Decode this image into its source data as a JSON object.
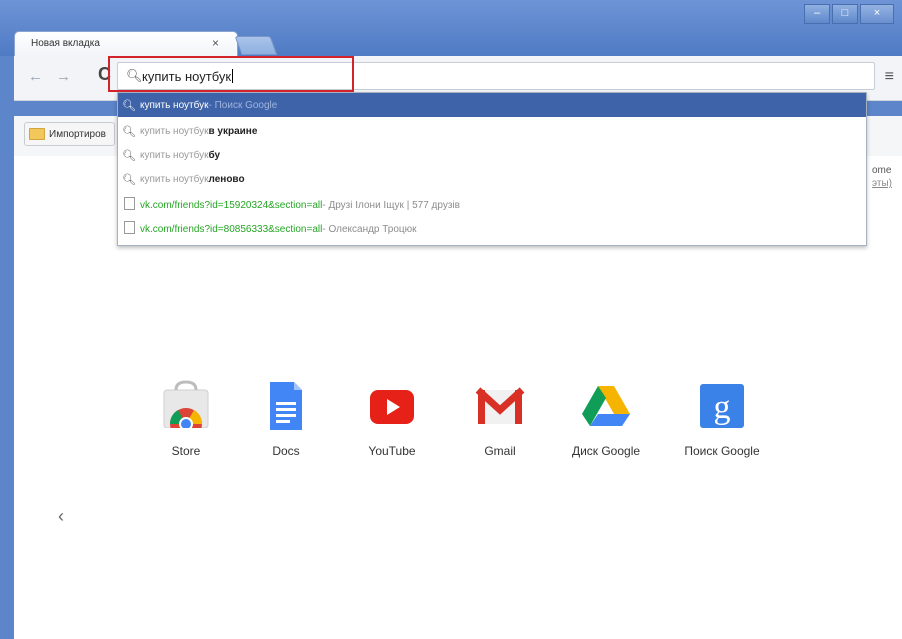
{
  "window": {
    "tab_title": "Новая вкладка",
    "tab_close": "×",
    "buttons": {
      "minimize": "–",
      "maximize": "□",
      "close": "×"
    }
  },
  "toolbar": {
    "back": "←",
    "forward": "→",
    "reload": "C",
    "omnibox_value": "купить ноутбук",
    "menu": "≡"
  },
  "bookmarks": {
    "item_label": "Импортиров"
  },
  "suggestions": [
    {
      "icon": "search-icon",
      "query": "купить ноутбук",
      "bold": "",
      "desc": " - Поиск Google",
      "selected": true
    },
    {
      "icon": "search-icon",
      "query": "купить ноутбук ",
      "bold": "в украине",
      "desc": "",
      "selected": false
    },
    {
      "icon": "search-icon",
      "query": "купить ноутбук ",
      "bold": "бу",
      "desc": "",
      "selected": false
    },
    {
      "icon": "search-icon",
      "query": "купить ноутбук ",
      "bold": "леново",
      "desc": "",
      "selected": false
    },
    {
      "icon": "page-icon",
      "url": "vk.com/friends?id=15920324&section=all",
      "desc": " - Друзі Ілони Іщук | 577 друзів",
      "selected": false
    },
    {
      "icon": "page-icon",
      "url": "vk.com/friends?id=80856333&section=all",
      "desc": " - Олександр Троцюк",
      "selected": false
    }
  ],
  "side_text": {
    "line1": "ome",
    "line2": "эты)"
  },
  "apps": [
    {
      "name": "store-icon",
      "label": "Store"
    },
    {
      "name": "docs-icon",
      "label": "Docs"
    },
    {
      "name": "youtube-icon",
      "label": "YouTube"
    },
    {
      "name": "gmail-icon",
      "label": "Gmail"
    },
    {
      "name": "google-drive-icon",
      "label": "Диск Google"
    },
    {
      "name": "google-search-icon",
      "label": "Поиск Google"
    }
  ],
  "pager_prev": "‹",
  "colors": {
    "chrome_blue": "#5d85c9",
    "selected_suggestion": "#3e63a8",
    "highlight_box": "#d2232a",
    "url_green": "#23a523"
  }
}
